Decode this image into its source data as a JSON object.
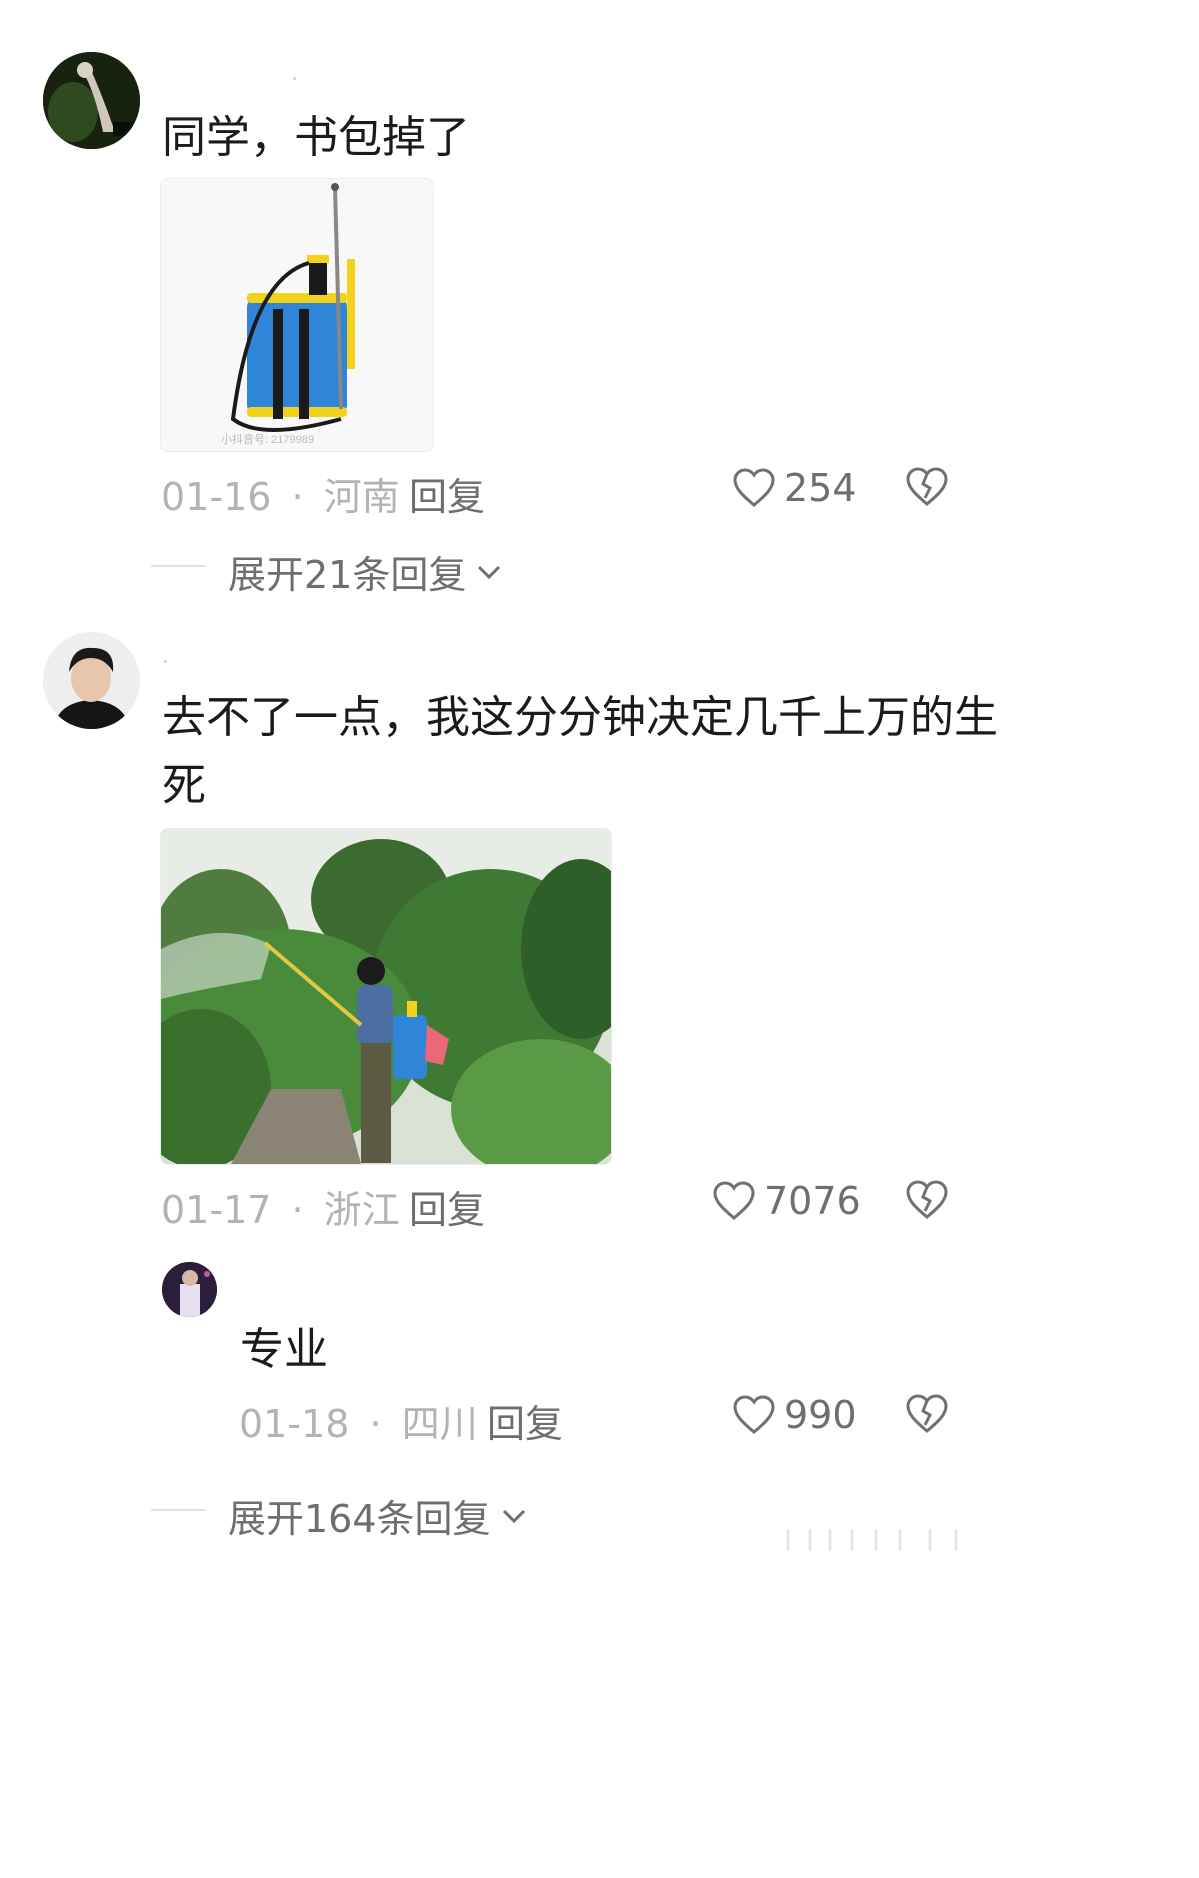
{
  "comments": [
    {
      "text": "同学，书包掉了",
      "date": "01-16",
      "sep": "·",
      "location": "河南",
      "reply_label": "回复",
      "likes": "254",
      "expand_label": "展开21条回复"
    },
    {
      "text_line1": "去不了一点，我这分分钟决定几千上万的生",
      "text_line2": "死",
      "date": "01-17",
      "sep": "·",
      "location": "浙江",
      "reply_label": "回复",
      "likes": "7076",
      "expand_label": "展开164条回复"
    }
  ],
  "subreply": {
    "text": "专业",
    "date": "01-18",
    "sep": "·",
    "location": "四川",
    "reply_label": "回复",
    "likes": "990"
  },
  "colors": {
    "text": "#1b1b1b",
    "meta": "#b3b3b3",
    "action": "#6e6e6e",
    "sprayer_blue": "#2f86d8",
    "sprayer_yellow": "#f2d21b",
    "foliage": "#3f7a35"
  },
  "icons": [
    "heart-outline-icon",
    "broken-heart-icon",
    "chevron-down-icon"
  ]
}
